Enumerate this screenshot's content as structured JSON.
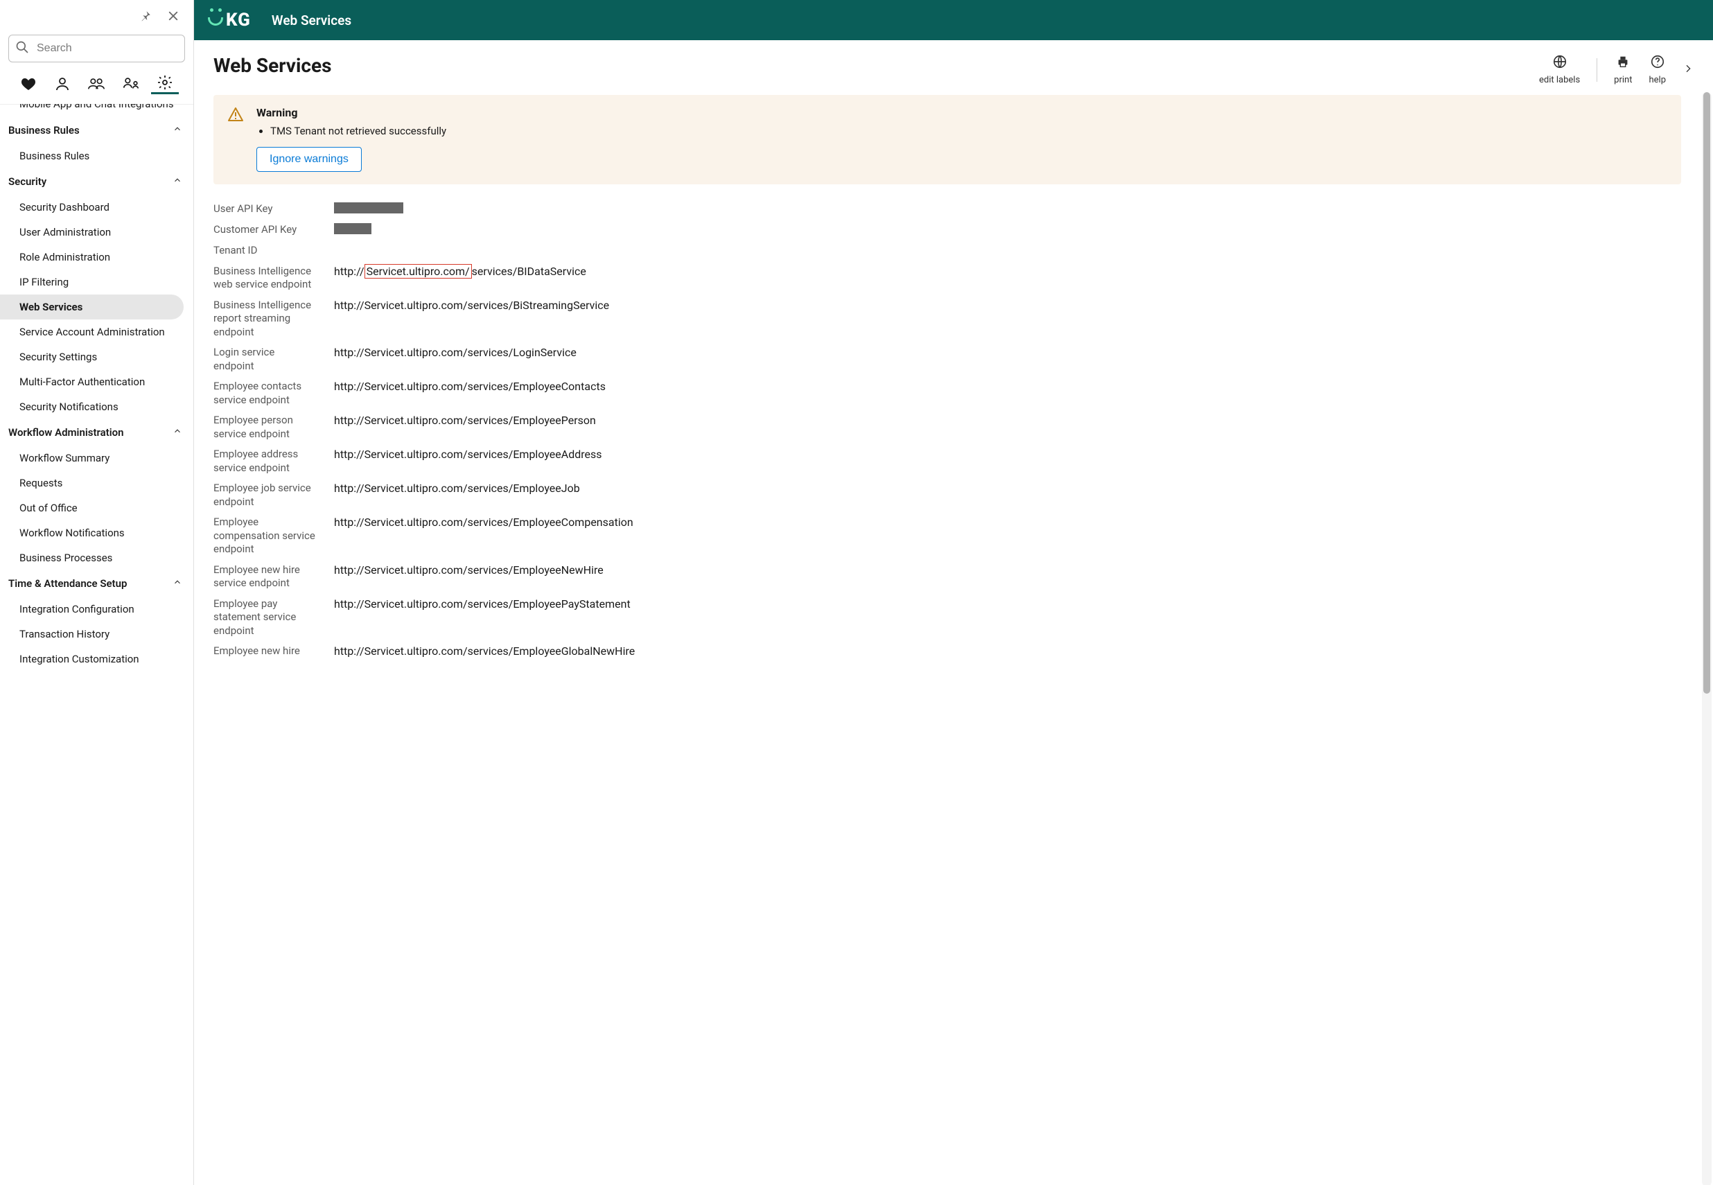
{
  "sidebar": {
    "search_placeholder": "Search",
    "cutoff_item": "Mobile App and Chat Integrations",
    "sections": [
      {
        "title": "Business Rules",
        "items": [
          {
            "label": "Business Rules"
          }
        ]
      },
      {
        "title": "Security",
        "items": [
          {
            "label": "Security Dashboard"
          },
          {
            "label": "User Administration"
          },
          {
            "label": "Role Administration"
          },
          {
            "label": "IP Filtering"
          },
          {
            "label": "Web Services",
            "active": true
          },
          {
            "label": "Service Account Administration"
          },
          {
            "label": "Security Settings"
          },
          {
            "label": "Multi-Factor Authentication"
          },
          {
            "label": "Security Notifications"
          }
        ]
      },
      {
        "title": "Workflow Administration",
        "items": [
          {
            "label": "Workflow Summary"
          },
          {
            "label": "Requests"
          },
          {
            "label": "Out of Office"
          },
          {
            "label": "Workflow Notifications"
          },
          {
            "label": "Business Processes"
          }
        ]
      },
      {
        "title": "Time & Attendance Setup",
        "items": [
          {
            "label": "Integration Configuration"
          },
          {
            "label": "Transaction History"
          },
          {
            "label": "Integration Customization"
          }
        ]
      }
    ]
  },
  "topbar": {
    "brand": "UKG",
    "title": "Web Services"
  },
  "page": {
    "title": "Web Services",
    "actions": {
      "edit_labels": "edit labels",
      "print": "print",
      "help": "help"
    }
  },
  "alert": {
    "title": "Warning",
    "message": "TMS Tenant not retrieved successfully",
    "ignore_label": "Ignore warnings"
  },
  "fields": [
    {
      "label": "User API Key",
      "value": "",
      "redacted": "w1"
    },
    {
      "label": "Customer API Key",
      "value": "",
      "redacted": "w2"
    },
    {
      "label": "Tenant ID",
      "value": ""
    },
    {
      "label": "Business Intelligence web service endpoint",
      "value_pre": "http://",
      "value_hl": "Servicet.ultipro.com/",
      "value_post": "services/BIDataService"
    },
    {
      "label": "Business Intelligence report streaming endpoint",
      "value": "http://Servicet.ultipro.com/services/BiStreamingService"
    },
    {
      "label": "Login service endpoint",
      "value": "http://Servicet.ultipro.com/services/LoginService"
    },
    {
      "label": "Employee contacts service endpoint",
      "value": "http://Servicet.ultipro.com/services/EmployeeContacts"
    },
    {
      "label": "Employee person service endpoint",
      "value": "http://Servicet.ultipro.com/services/EmployeePerson"
    },
    {
      "label": "Employee address service endpoint",
      "value": "http://Servicet.ultipro.com/services/EmployeeAddress"
    },
    {
      "label": "Employee job service endpoint",
      "value": "http://Servicet.ultipro.com/services/EmployeeJob"
    },
    {
      "label": "Employee compensation service endpoint",
      "value": "http://Servicet.ultipro.com/services/EmployeeCompensation"
    },
    {
      "label": "Employee new hire service endpoint",
      "value": "http://Servicet.ultipro.com/services/EmployeeNewHire"
    },
    {
      "label": "Employee pay statement service endpoint",
      "value": "http://Servicet.ultipro.com/services/EmployeePayStatement"
    },
    {
      "label": "Employee new hire",
      "value": "http://Servicet.ultipro.com/services/EmployeeGlobalNewHire"
    }
  ],
  "colors": {
    "primary": "#085d58",
    "link": "#0a7bd6",
    "warning": "#b37a16",
    "highlight": "#d63a2a"
  }
}
